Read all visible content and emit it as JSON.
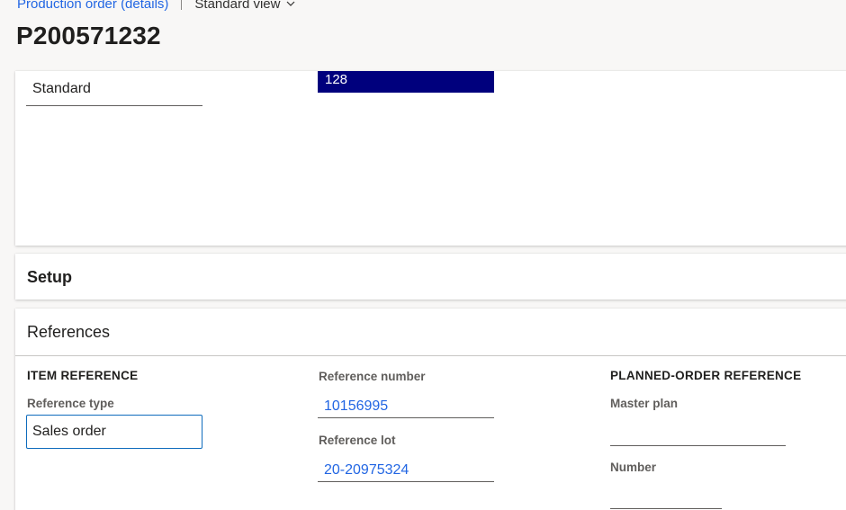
{
  "breadcrumb": {
    "link": "Production order (details)",
    "view": "Standard view"
  },
  "page_title": "P200571232",
  "top_card": {
    "standard_value": "Standard",
    "selected_value": "128"
  },
  "setup": {
    "title": "Setup"
  },
  "references": {
    "title": "References",
    "item_reference": {
      "title": "ITEM REFERENCE",
      "reference_type_label": "Reference type",
      "reference_type_value": "Sales order"
    },
    "reference_number": {
      "label": "Reference number",
      "value": "10156995"
    },
    "reference_lot": {
      "label": "Reference lot",
      "value": "20-20975324"
    },
    "planned_order_reference": {
      "title": "PLANNED-ORDER REFERENCE",
      "master_plan_label": "Master plan",
      "master_plan_value": "",
      "number_label": "Number",
      "number_value": ""
    }
  },
  "colors": {
    "accent": "#2266e3",
    "selection": "#00007d",
    "focus_border": "#0f6cbd"
  }
}
